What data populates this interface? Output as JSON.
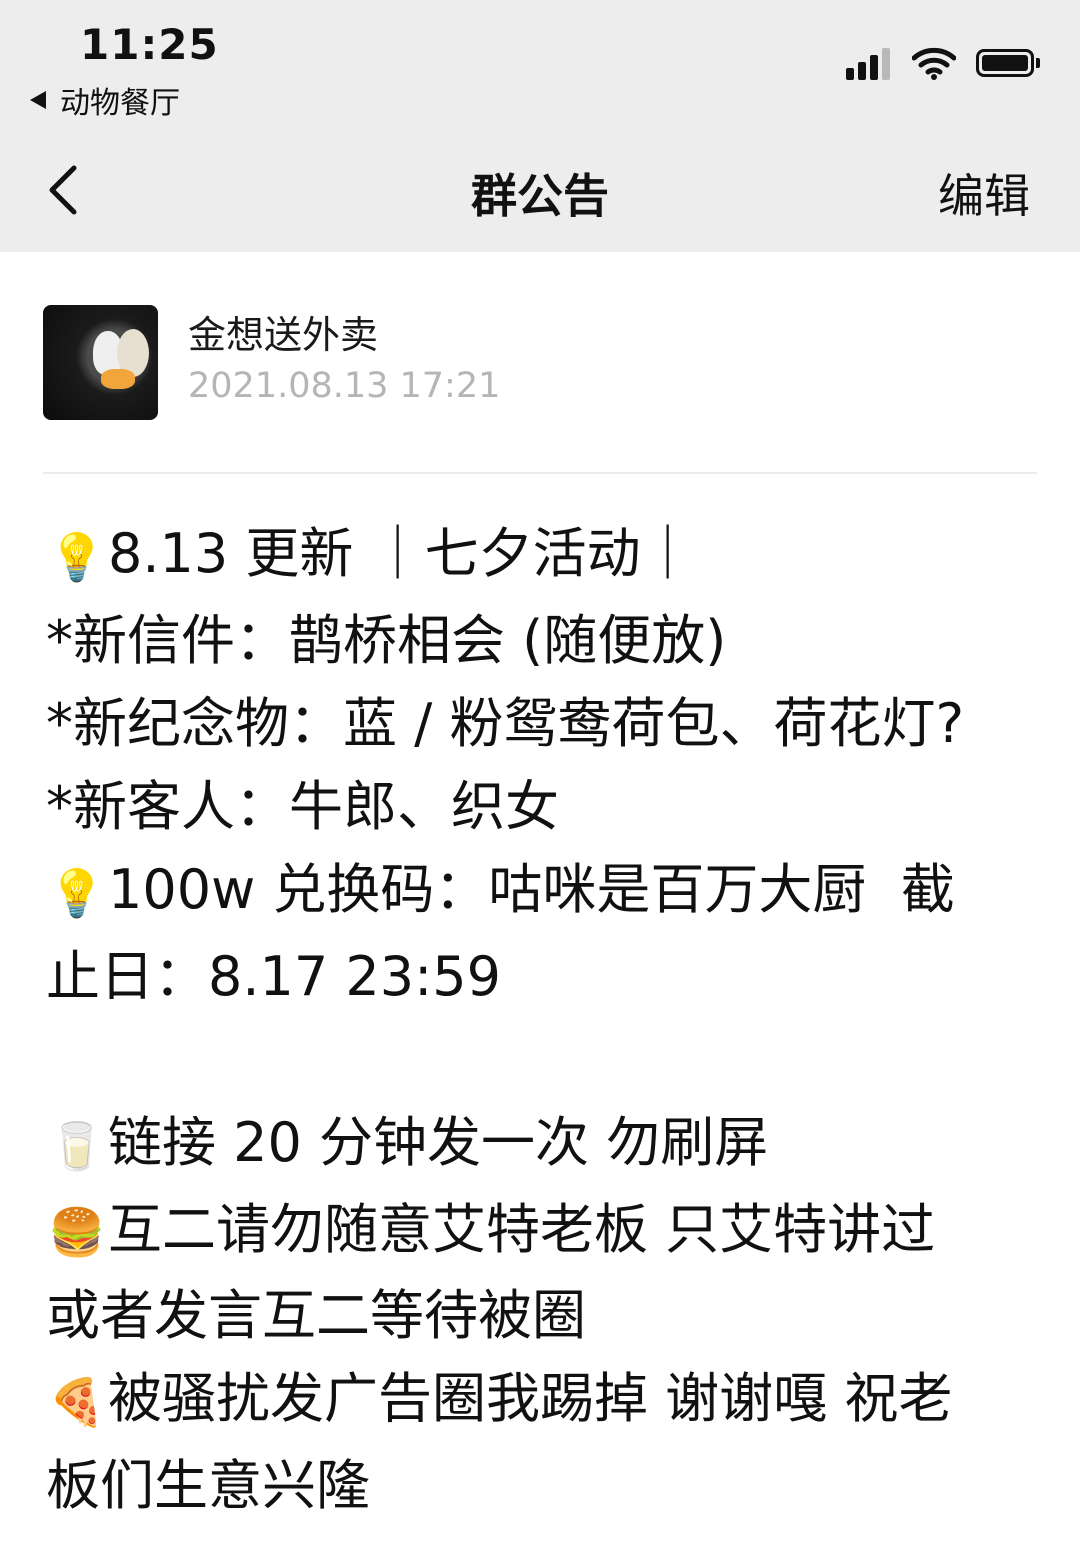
{
  "status_bar": {
    "time": "11:25",
    "back_app": "动物餐厅"
  },
  "nav": {
    "title": "群公告",
    "edit_label": "编辑"
  },
  "announcement": {
    "author": "金想送外卖",
    "datetime": "2021.08.13  17:21",
    "lines": [
      {
        "icon": "lightbulb-icon",
        "glyph": "💡",
        "text": "8.13 更新 ｜七夕活动｜"
      },
      {
        "icon": "",
        "glyph": "",
        "text": "*新信件：鹊桥相会 (随便放)"
      },
      {
        "icon": "",
        "glyph": "",
        "text": "*新纪念物：蓝 / 粉鸳鸯荷包、荷花灯?"
      },
      {
        "icon": "",
        "glyph": "",
        "text": "*新客人：牛郎、织女"
      },
      {
        "icon": "lightbulb-icon",
        "glyph": "💡",
        "text": "100w 兑换码：咕咪是百万大厨  截"
      },
      {
        "icon": "",
        "glyph": "",
        "text": "止日：8.17 23:59"
      },
      {
        "icon": "",
        "glyph": "",
        "text": ""
      },
      {
        "icon": "milk-glass-icon",
        "glyph": "🥛",
        "text": "链接 20 分钟发一次 勿刷屏"
      },
      {
        "icon": "burger-icon",
        "glyph": "🍔",
        "text": "互二请勿随意艾特老板 只艾特讲过"
      },
      {
        "icon": "",
        "glyph": "",
        "text": "或者发言互二等待被圈"
      },
      {
        "icon": "pizza-icon",
        "glyph": "🍕",
        "text": "被骚扰发广告圈我踢掉 谢谢嘎 祝老"
      },
      {
        "icon": "",
        "glyph": "",
        "text": "板们生意兴隆"
      }
    ]
  }
}
